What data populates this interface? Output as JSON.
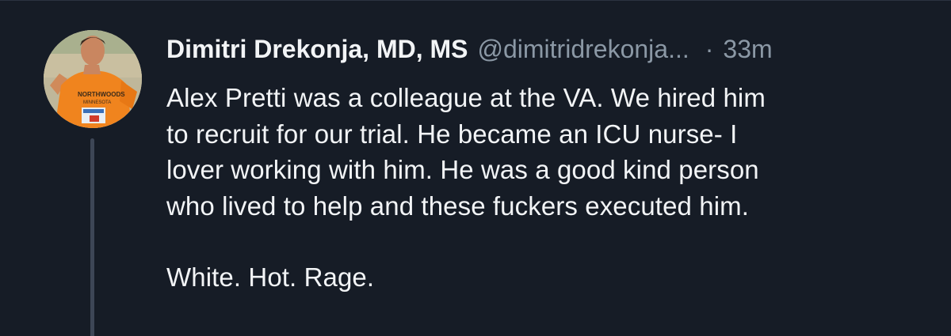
{
  "post": {
    "author": {
      "display_name": "Dimitri Drekonja, MD, MS",
      "handle": "@dimitridrekonja...",
      "avatar_icon": "profile-photo-runner-orange-shirt"
    },
    "separator": "·",
    "timestamp": "33m",
    "paragraphs": [
      "Alex Pretti was a colleague at the VA. We hired him\nto recruit for our trial. He became an ICU nurse- I\nlover working with him. He was a good kind person\nwho lived to help and these fuckers executed him.",
      "White. Hot. Rage."
    ]
  },
  "colors": {
    "background": "#161c26",
    "text_primary": "#f2f4f6",
    "text_secondary": "#8b98a5",
    "thread_line": "#3d4656"
  }
}
